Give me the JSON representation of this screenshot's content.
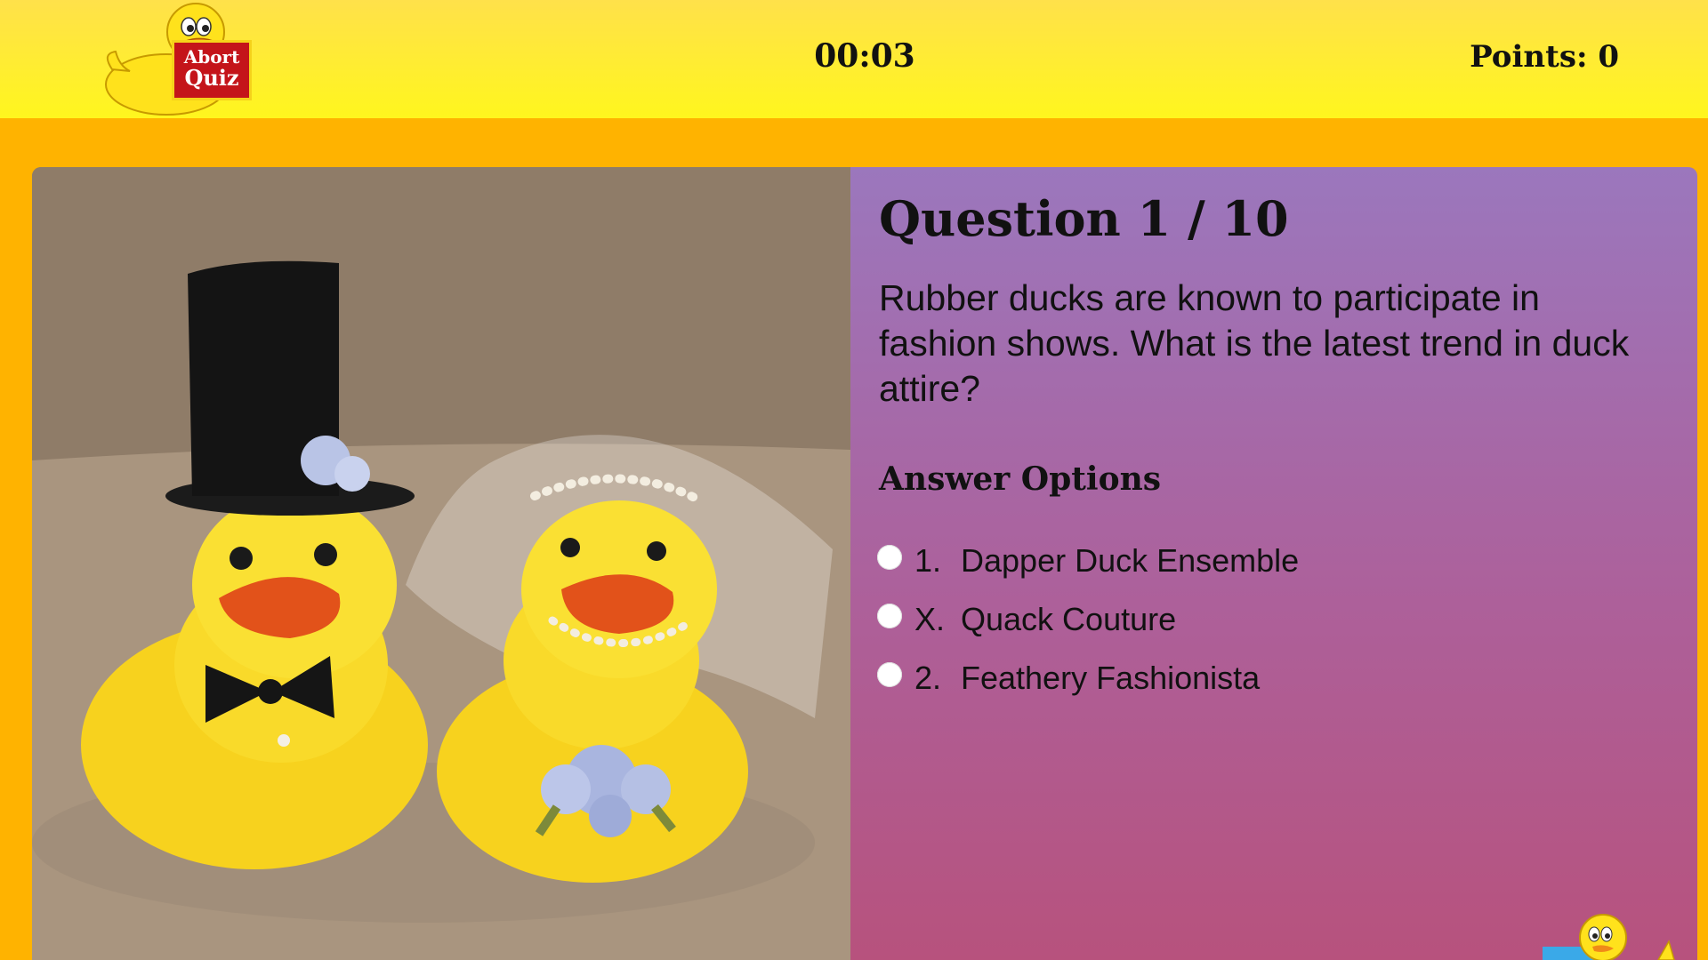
{
  "header": {
    "logo": {
      "icon": "duck-mascot-icon",
      "line1": "Abort",
      "line2": "Quiz"
    },
    "timer": "00:03",
    "points": "Points: 0"
  },
  "quiz": {
    "image_icon": "rubber-duck-wedding-couple-photo",
    "title": "Question 1 / 10",
    "question": "Rubber ducks are known to participate in fashion shows. What is the latest trend in duck attire?",
    "options_heading": "Answer Options",
    "options": [
      {
        "key": "1.",
        "label": "Dapper Duck Ensemble"
      },
      {
        "key": "X.",
        "label": "Quack Couture"
      },
      {
        "key": "2.",
        "label": "Feathery Fashionista"
      }
    ],
    "corner_icon": "duck-mascot-icon"
  },
  "colors": {
    "header_yellow": "#fff61e",
    "background_orange": "#ffb300",
    "panel_top": "#9b77bd",
    "panel_bottom": "#b7527d",
    "sign_red": "#c4141a"
  }
}
